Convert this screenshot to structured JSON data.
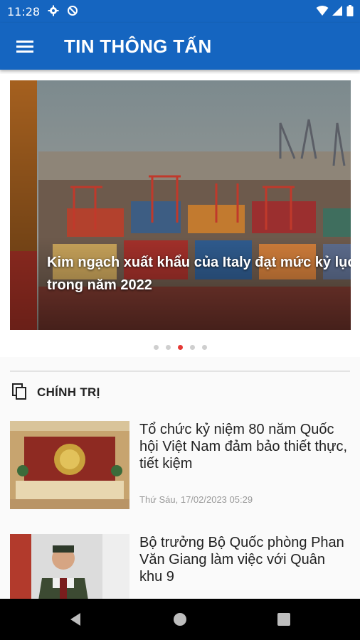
{
  "status_bar": {
    "time": "11:28"
  },
  "app_bar": {
    "title": "TIN THÔNG TẤN"
  },
  "carousel": {
    "slide_title_line1": "Kim ngạch xuất khẩu của Italy đạt mức kỷ lục",
    "slide_title_line2": "trong năm 2022",
    "total_slides": 5,
    "active_index": 2
  },
  "section": {
    "title": "CHÍNH TRỊ"
  },
  "articles": [
    {
      "title": "Tổ chức kỷ niệm 80 năm Quốc hội Việt Nam đảm bảo thiết thực, tiết kiệm",
      "time": "Thứ Sáu, 17/02/2023 05:29"
    },
    {
      "title": "Bộ trưởng Bộ Quốc phòng Phan Văn Giang làm việc với Quân khu 9",
      "time": ""
    }
  ],
  "colors": {
    "primary": "#1565c0",
    "accent_dot": "#e53935"
  }
}
